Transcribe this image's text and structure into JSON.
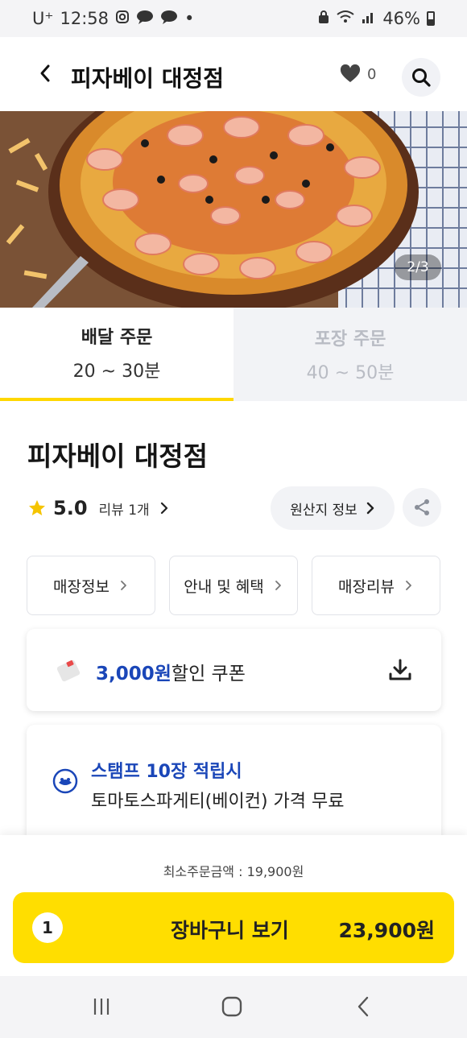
{
  "status_bar": {
    "carrier": "U⁺",
    "time": "12:58",
    "dot": "•",
    "battery": "46%"
  },
  "header": {
    "title": "피자베이 대정점",
    "like_count": "0"
  },
  "hero": {
    "page_indicator": "2/3"
  },
  "order_tabs": [
    {
      "label": "배달 주문",
      "time": "20 ~ 30분",
      "active": true
    },
    {
      "label": "포장 주문",
      "time": "40 ~ 50분",
      "active": false
    }
  ],
  "store": {
    "name": "피자베이 대정점",
    "rating": "5.0",
    "review_label": "리뷰 1개",
    "origin_label": "원산지 정보"
  },
  "info_buttons": [
    {
      "label": "매장정보"
    },
    {
      "label": "안내 및 혜택"
    },
    {
      "label": "매장리뷰"
    }
  ],
  "coupon": {
    "amount": "3,000원",
    "suffix": "할인 쿠폰"
  },
  "stamp": {
    "title": "스탬프 10장 적립시",
    "description": "토마토스파게티(베이컨) 가격 무료"
  },
  "order_bar": {
    "min_order": "최소주문금액 : 19,900원",
    "cart_count": "1",
    "cart_label": "장바구니 보기",
    "cart_total": "23,900원"
  },
  "colors": {
    "accent_yellow": "#ffde00",
    "tab_underline": "#ffd700",
    "link_blue": "#1a46b8",
    "star": "#f5c400"
  }
}
